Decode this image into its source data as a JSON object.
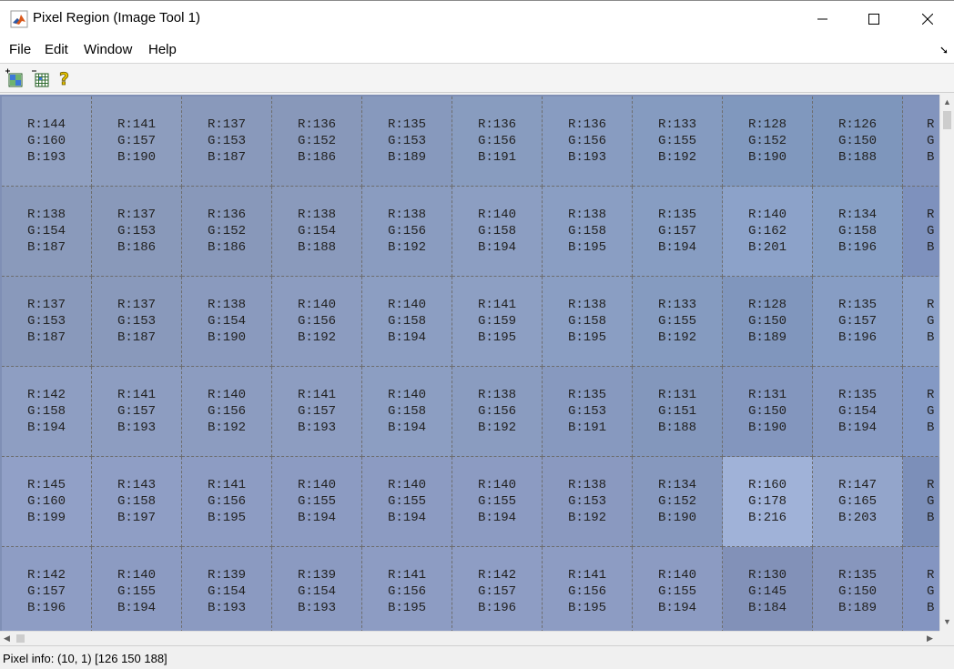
{
  "window": {
    "title": "Pixel Region (Image Tool 1)",
    "controls": {
      "minimize": "minimize-icon",
      "maximize": "maximize-icon",
      "close": "close-icon"
    }
  },
  "menu": {
    "items": [
      "File",
      "Edit",
      "Window",
      "Help"
    ],
    "dock_icon": "dock-arrow-icon",
    "dock_glyph": "➘"
  },
  "toolbar": {
    "buttons": [
      {
        "name": "expand-grid",
        "icon": "expand-grid-icon"
      },
      {
        "name": "shrink-grid",
        "icon": "shrink-grid-icon"
      },
      {
        "name": "help",
        "icon": "help-question-icon"
      }
    ]
  },
  "pixel_grid": {
    "rows": [
      [
        [
          144,
          160,
          193
        ],
        [
          141,
          157,
          190
        ],
        [
          137,
          153,
          187
        ],
        [
          136,
          152,
          186
        ],
        [
          135,
          153,
          189
        ],
        [
          136,
          156,
          191
        ],
        [
          136,
          156,
          193
        ],
        [
          133,
          155,
          192
        ],
        [
          128,
          152,
          190
        ],
        [
          126,
          150,
          188
        ]
      ],
      [
        [
          138,
          154,
          187
        ],
        [
          137,
          153,
          186
        ],
        [
          136,
          152,
          186
        ],
        [
          138,
          154,
          188
        ],
        [
          138,
          156,
          192
        ],
        [
          140,
          158,
          194
        ],
        [
          138,
          158,
          195
        ],
        [
          135,
          157,
          194
        ],
        [
          140,
          162,
          201
        ],
        [
          134,
          158,
          196
        ]
      ],
      [
        [
          137,
          153,
          187
        ],
        [
          137,
          153,
          187
        ],
        [
          138,
          154,
          190
        ],
        [
          140,
          156,
          192
        ],
        [
          140,
          158,
          194
        ],
        [
          141,
          159,
          195
        ],
        [
          138,
          158,
          195
        ],
        [
          133,
          155,
          192
        ],
        [
          128,
          150,
          189
        ],
        [
          135,
          157,
          196
        ]
      ],
      [
        [
          142,
          158,
          194
        ],
        [
          141,
          157,
          193
        ],
        [
          140,
          156,
          192
        ],
        [
          141,
          157,
          193
        ],
        [
          140,
          158,
          194
        ],
        [
          138,
          156,
          192
        ],
        [
          135,
          153,
          191
        ],
        [
          131,
          151,
          188
        ],
        [
          131,
          150,
          190
        ],
        [
          135,
          154,
          194
        ]
      ],
      [
        [
          145,
          160,
          199
        ],
        [
          143,
          158,
          197
        ],
        [
          141,
          156,
          195
        ],
        [
          140,
          155,
          194
        ],
        [
          140,
          155,
          194
        ],
        [
          140,
          155,
          194
        ],
        [
          138,
          153,
          192
        ],
        [
          134,
          152,
          190
        ],
        [
          160,
          178,
          216
        ],
        [
          147,
          165,
          203
        ]
      ],
      [
        [
          142,
          157,
          196
        ],
        [
          140,
          155,
          194
        ],
        [
          139,
          154,
          193
        ],
        [
          139,
          154,
          193
        ],
        [
          141,
          156,
          195
        ],
        [
          142,
          157,
          196
        ],
        [
          141,
          156,
          195
        ],
        [
          140,
          155,
          194
        ],
        [
          130,
          145,
          184
        ],
        [
          135,
          150,
          189
        ]
      ]
    ],
    "partial_column_colors": [
      "#8294bd",
      "#7e91bd",
      "#8ba0c7",
      "#8499c4",
      "#7c8fb9",
      "#8495c1"
    ]
  },
  "status": {
    "text": "Pixel info: (10, 1)  [126 150 188]"
  }
}
